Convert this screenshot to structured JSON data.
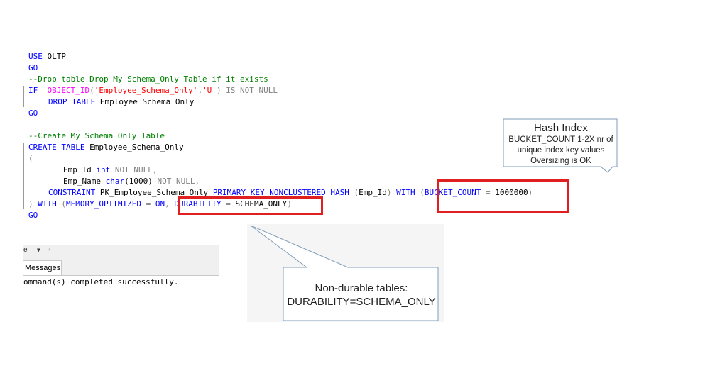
{
  "editor": {
    "line1": [
      "USE",
      " OLTP"
    ],
    "line2": [
      "GO"
    ],
    "line3": [
      "--Drop table Drop My Schema_Only Table if it exists"
    ],
    "line4": [
      "IF",
      "  ",
      "OBJECT_ID",
      "(",
      "'Employee_Schema_Only'",
      ",",
      "'U'",
      ")",
      " ",
      "IS NOT NULL"
    ],
    "line5": [
      "DROP",
      " ",
      "TABLE",
      " Employee_Schema_Only"
    ],
    "line6": [
      "GO"
    ],
    "line7": [
      "--Create My Schema_Only Table"
    ],
    "line8": [
      "CREATE",
      " ",
      "TABLE",
      " Employee_Schema_Only"
    ],
    "line9": [
      "("
    ],
    "line10": [
      "Emp_Id ",
      "int",
      " ",
      "NOT NULL,"
    ],
    "line11": [
      "Emp_Name ",
      "char",
      "(1000) ",
      "NOT NULL,"
    ],
    "line12": [
      "CONSTRAINT",
      " PK_Employee_Schema_Only ",
      "PRIMARY KEY NONCLUSTERED HASH",
      " ",
      "(",
      "Emp_Id",
      ")",
      " ",
      "WITH",
      " ",
      "(",
      "BUCKET_COUNT",
      " = ",
      "1000000",
      ")"
    ],
    "line13": [
      ")",
      " ",
      "WITH",
      " ",
      "(",
      "MEMORY_OPTIMIZED",
      " = ",
      "ON",
      ",",
      " ",
      "DURABILITY",
      " = ",
      "SCHEMA_ONLY",
      ")"
    ],
    "line14": [
      "GO"
    ]
  },
  "callouts": {
    "hash_title": "Hash Index",
    "hash_body": "BUCKET_COUNT 1-2X nr of unique index key values Oversizing is OK",
    "nondurable_line1": "Non-durable tables:",
    "nondurable_line2": "DURABILITY=SCHEMA_ONLY"
  },
  "results": {
    "dropdown_fragment": "e",
    "tab_label": "Messages",
    "message": "ommand(s) completed successfully."
  },
  "colors": {
    "highlight_box": "#e02020",
    "keyword": "#0000ff",
    "function": "#ff00ff",
    "string": "#ff0000",
    "comment": "#008000",
    "operator": "#808080"
  }
}
